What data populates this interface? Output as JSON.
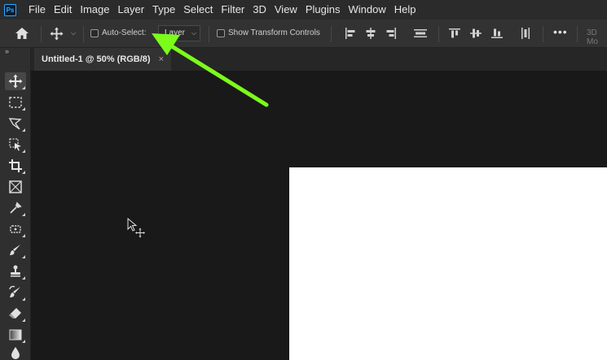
{
  "app": {
    "logo_text": "Ps"
  },
  "menubar": {
    "items": [
      "File",
      "Edit",
      "Image",
      "Layer",
      "Type",
      "Select",
      "Filter",
      "3D",
      "View",
      "Plugins",
      "Window",
      "Help"
    ]
  },
  "options": {
    "auto_select_label": "Auto-Select:",
    "auto_select_checked": false,
    "auto_select_target": "Layer",
    "show_transform_label": "Show Transform Controls",
    "show_transform_checked": false,
    "mode_3d_label": "3D Mo"
  },
  "document": {
    "tab_title": "Untitled-1 @ 50% (RGB/8)",
    "close_glyph": "×"
  },
  "annotation": {
    "arrow_color": "#7cfc1a"
  },
  "colors": {
    "canvas": "#ffffff",
    "workspace": "#191919",
    "chrome": "#323232"
  }
}
